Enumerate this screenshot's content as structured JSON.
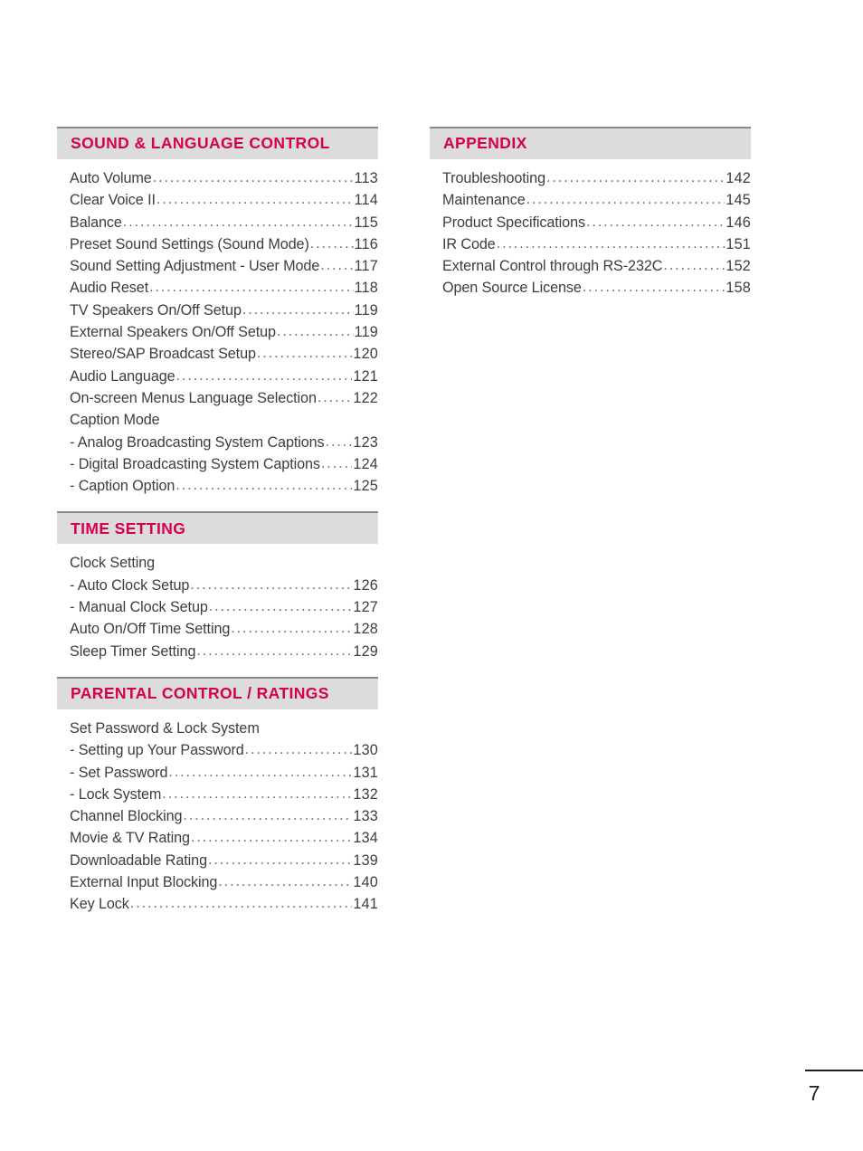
{
  "document": {
    "page_number": "7"
  },
  "colors": {
    "header_text": "#d50050",
    "header_bar": "#dcdcdc",
    "header_rule": "#898989",
    "body_text": "#3d3d3d",
    "leader": "#6e6e6e"
  },
  "columns": [
    {
      "sections": [
        {
          "title": "SOUND & LANGUAGE CONTROL",
          "entries": [
            {
              "label": "Auto Volume",
              "page": "113"
            },
            {
              "label": "Clear Voice II ",
              "page": "114"
            },
            {
              "label": "Balance ",
              "page": "115"
            },
            {
              "label": "Preset Sound Settings (Sound Mode) ",
              "page": "116"
            },
            {
              "label": "Sound Setting Adjustment - User Mode",
              "page": "117"
            },
            {
              "label": "Audio Reset",
              "page": "118"
            },
            {
              "label": "TV Speakers On/Off Setup ",
              "page": "119"
            },
            {
              "label": "External Speakers On/Off Setup ",
              "page": "119"
            },
            {
              "label": "Stereo/SAP Broadcast Setup ",
              "page": "120"
            },
            {
              "label": "Audio Language  ",
              "page": "121"
            },
            {
              "label": "On-screen Menus Language Selection",
              "page": "122"
            },
            {
              "label": "Caption Mode",
              "page": ""
            },
            {
              "label": "- Analog Broadcasting System Captions ",
              "page": "123"
            },
            {
              "label": "- Digital Broadcasting System Captions",
              "page": "124"
            },
            {
              "label": "- Caption Option",
              "page": "125"
            }
          ]
        },
        {
          "title": "TIME SETTING",
          "entries": [
            {
              "label": "Clock Setting",
              "page": ""
            },
            {
              "label": "- Auto Clock Setup",
              "page": "126"
            },
            {
              "label": "- Manual Clock Setup ",
              "page": "127"
            },
            {
              "label": "Auto On/Off Time Setting",
              "page": "128"
            },
            {
              "label": "Sleep Timer Setting",
              "page": "129"
            }
          ]
        },
        {
          "title": "PARENTAL CONTROL / RATINGS",
          "entries": [
            {
              "label": "Set Password & Lock System",
              "page": ""
            },
            {
              "label": "- Setting up Your Password",
              "page": "130"
            },
            {
              "label": "- Set Password ",
              "page": "131"
            },
            {
              "label": "- Lock System",
              "page": "132"
            },
            {
              "label": "Channel Blocking",
              "page": "133"
            },
            {
              "label": "Movie & TV Rating ",
              "page": "134"
            },
            {
              "label": "Downloadable Rating",
              "page": "139"
            },
            {
              "label": "External Input Blocking ",
              "page": "140"
            },
            {
              "label": "Key Lock ",
              "page": "141"
            }
          ]
        }
      ]
    },
    {
      "sections": [
        {
          "title": "APPENDIX",
          "entries": [
            {
              "label": "Troubleshooting",
              "page": "142"
            },
            {
              "label": "Maintenance",
              "page": "145"
            },
            {
              "label": "Product Specifications ",
              "page": "146"
            },
            {
              "label": "IR Code",
              "page": "151"
            },
            {
              "label": "External Control through RS-232C ",
              "page": "152"
            },
            {
              "label": "Open Source License",
              "page": "158"
            }
          ]
        }
      ]
    }
  ]
}
